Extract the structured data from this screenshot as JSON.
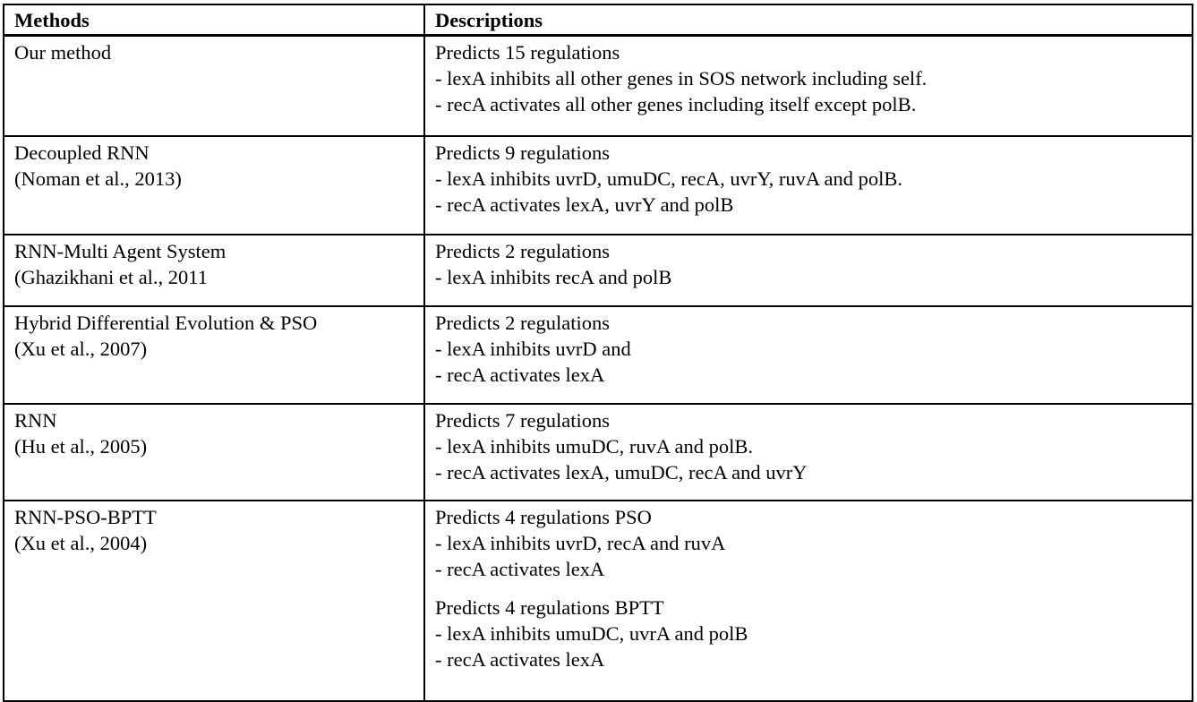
{
  "table": {
    "columns": [
      {
        "key": "methods",
        "header": "Methods"
      },
      {
        "key": "descriptions",
        "header": "Descriptions"
      }
    ],
    "rows": [
      {
        "id": "our-method",
        "method_lines": [
          "Our method"
        ],
        "description_blocks": [
          {
            "lines": [
              "Predicts 15 regulations",
              "- lexA inhibits all other genes in SOS network including self.",
              "- recA activates all other genes including itself except polB."
            ]
          }
        ]
      },
      {
        "id": "decoupled-rnn",
        "method_lines": [
          "Decoupled RNN",
          "(Noman et al., 2013)"
        ],
        "description_blocks": [
          {
            "lines": [
              "Predicts 9 regulations",
              "- lexA inhibits uvrD, umuDC, recA, uvrY, ruvA and polB.",
              "- recA activates lexA, uvrY and polB"
            ]
          }
        ]
      },
      {
        "id": "rnn-multi-agent-system",
        "method_lines": [
          "RNN-Multi Agent System",
          "(Ghazikhani et al., 2011"
        ],
        "description_blocks": [
          {
            "lines": [
              "Predicts 2 regulations",
              "- lexA inhibits recA and polB"
            ]
          }
        ]
      },
      {
        "id": "hybrid-differential-evolution-pso",
        "method_lines": [
          "Hybrid Differential Evolution & PSO",
          "(Xu et al., 2007)"
        ],
        "description_blocks": [
          {
            "lines": [
              "Predicts 2 regulations",
              "- lexA inhibits uvrD and",
              "- recA activates lexA"
            ]
          }
        ]
      },
      {
        "id": "rnn-hu",
        "method_lines": [
          "RNN",
          "(Hu et al., 2005)"
        ],
        "description_blocks": [
          {
            "lines": [
              "Predicts 7 regulations",
              "- lexA inhibits umuDC, ruvA and polB.",
              "- recA activates lexA, umuDC, recA and uvrY"
            ]
          }
        ]
      },
      {
        "id": "rnn-pso-bptt",
        "method_lines": [
          "RNN-PSO-BPTT",
          "(Xu et al., 2004)"
        ],
        "description_blocks": [
          {
            "lines": [
              "Predicts 4 regulations PSO",
              "- lexA inhibits uvrD, recA and ruvA",
              "- recA activates lexA"
            ]
          },
          {
            "lines": [
              "Predicts 4 regulations BPTT",
              "- lexA inhibits umuDC, uvrA and polB",
              "- recA activates lexA"
            ]
          }
        ]
      }
    ]
  },
  "style": {
    "border_color": "#000000",
    "text_color": "#000000",
    "background_color": "#ffffff"
  }
}
